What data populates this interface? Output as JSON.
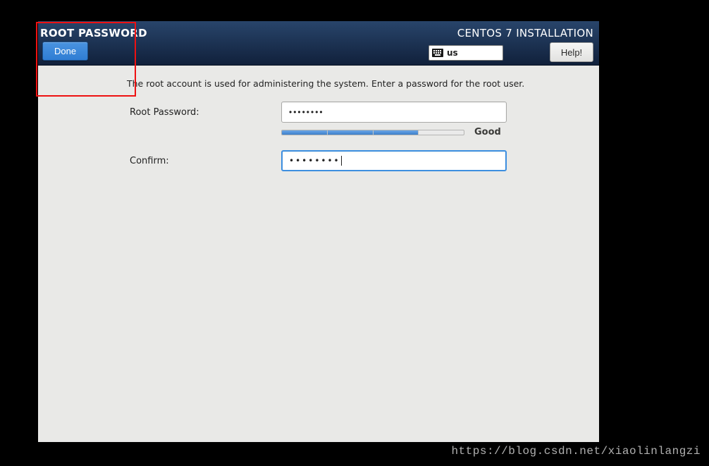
{
  "header": {
    "title": "ROOT PASSWORD",
    "done_label": "Done",
    "right_title": "CENTOS 7 INSTALLATION",
    "keyboard_layout": "us",
    "help_label": "Help!"
  },
  "form": {
    "description": "The root account is used for administering the system.  Enter a password for the root user.",
    "root_password_label": "Root Password:",
    "root_password_value": "••••••••",
    "confirm_label": "Confirm:",
    "confirm_value": "••••••••",
    "strength_label": "Good",
    "strength_percent": 75
  },
  "watermark": "https://blog.csdn.net/xiaolinlangzi",
  "colors": {
    "accent": "#3d8fe0",
    "header_bg": "#0e2240"
  }
}
